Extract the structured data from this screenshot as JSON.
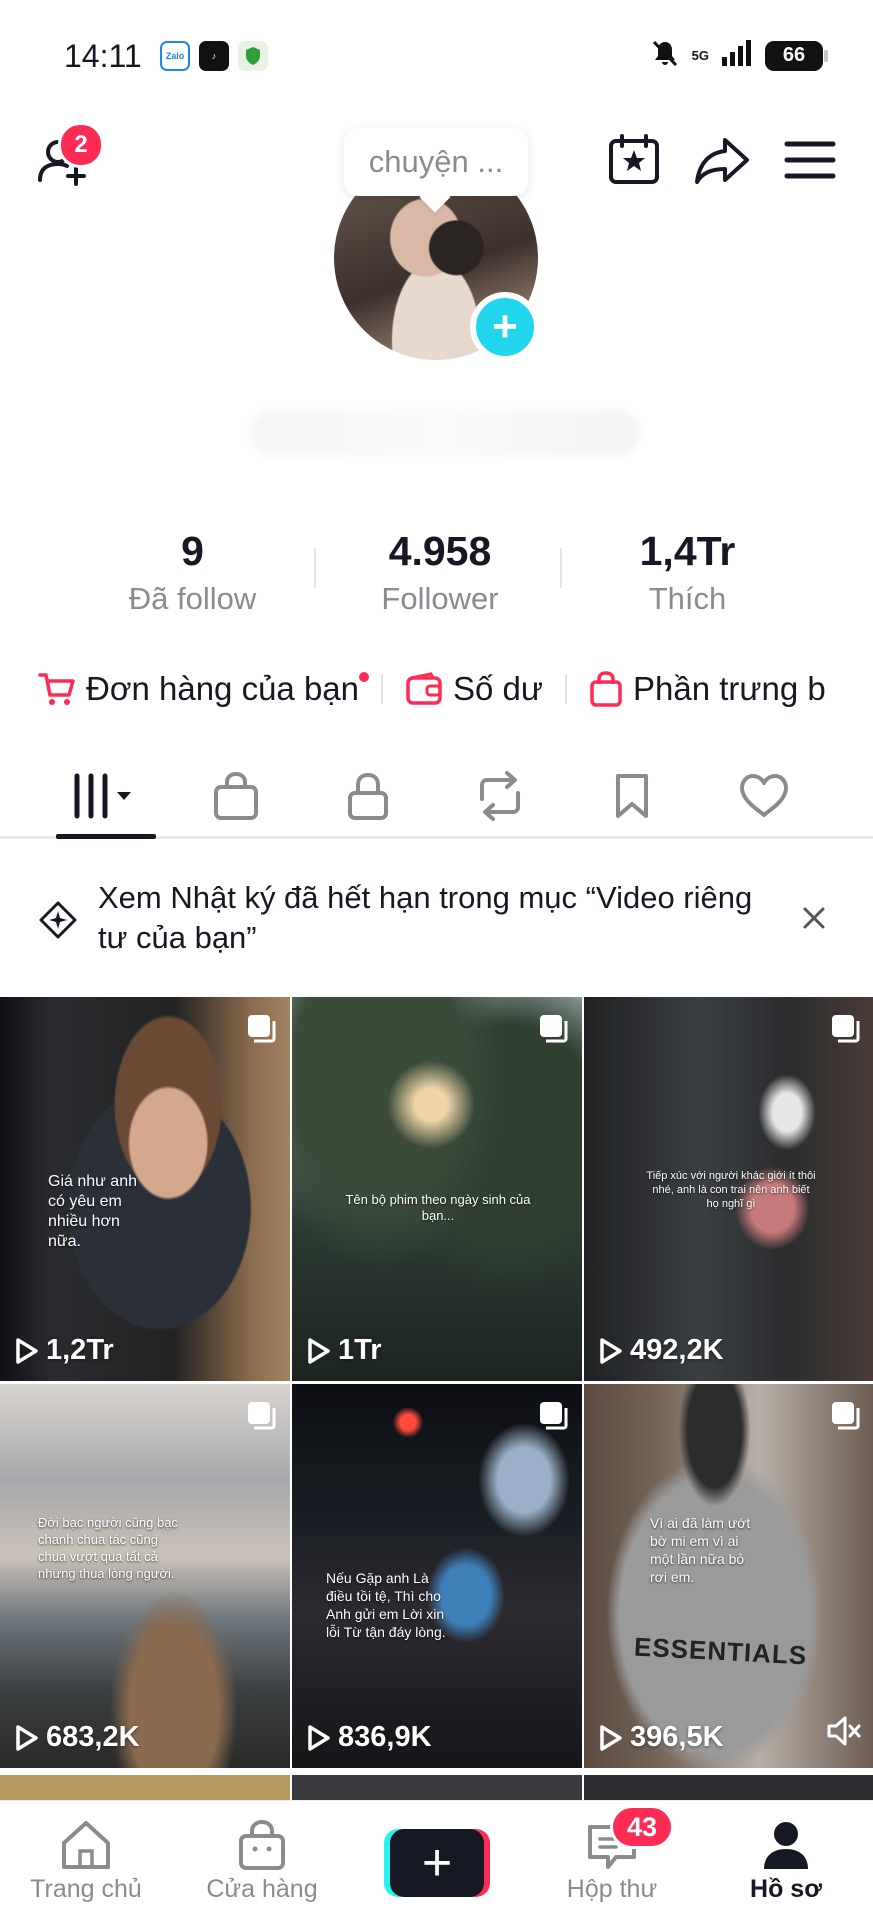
{
  "status_bar": {
    "time": "14:11",
    "battery": "66",
    "network": "5G",
    "apps": [
      "zalo-icon",
      "tiktok-icon",
      "shield-icon"
    ]
  },
  "header": {
    "add_friend_badge": "2",
    "tooltip_text": "chuyện ..."
  },
  "stats": [
    {
      "value": "9",
      "label": "Đã follow"
    },
    {
      "value": "4.958",
      "label": "Follower"
    },
    {
      "value": "1,4Tr",
      "label": "Thích"
    }
  ],
  "shortcuts": [
    {
      "label": "Đơn hàng của bạn",
      "icon": "cart-icon"
    },
    {
      "label": "Số dư",
      "icon": "wallet-icon"
    },
    {
      "label": "Phần trưng b",
      "icon": "bag-icon"
    }
  ],
  "tabs": [
    "videos",
    "shop",
    "private",
    "reposts",
    "saved",
    "liked"
  ],
  "banner": {
    "text": "Xem Nhật ký đã hết hạn trong mục “Video riêng tư của bạn”"
  },
  "videos": [
    {
      "views": "1,2Tr",
      "caption": "Giá như anh có yêu em nhiều hơn nữa."
    },
    {
      "views": "1Tr",
      "caption": "Tên bộ phim theo ngày sinh của bạn..."
    },
    {
      "views": "492,2K",
      "caption": "Tiếp xúc với người khác giới ít thôi nhé, anh là con trai nên anh biết họ nghĩ gì"
    },
    {
      "views": "683,2K",
      "caption": "Đời bạc người cũng bạc chanh chua tác cũng chua vượt qua tất cả nhưng thua lòng người."
    },
    {
      "views": "836,9K",
      "caption": "Nếu Gặp anh Là điều tồi tệ, Thì cho Anh gửi em Lời xin lỗi Từ tận đáy lòng."
    },
    {
      "views": "396,5K",
      "caption": "Vì ai đã làm ướt bờ mi em vì ai một lần nữa bỏ rơi em."
    }
  ],
  "bottom_nav": {
    "home": "Trang chủ",
    "shop": "Cửa hàng",
    "inbox": "Hộp thư",
    "inbox_badge": "43",
    "profile": "Hồ sơ"
  },
  "colors": {
    "accent": "#fe2c55",
    "cyan": "#25f4ee",
    "text": "#161823",
    "muted": "#8a8b91"
  }
}
